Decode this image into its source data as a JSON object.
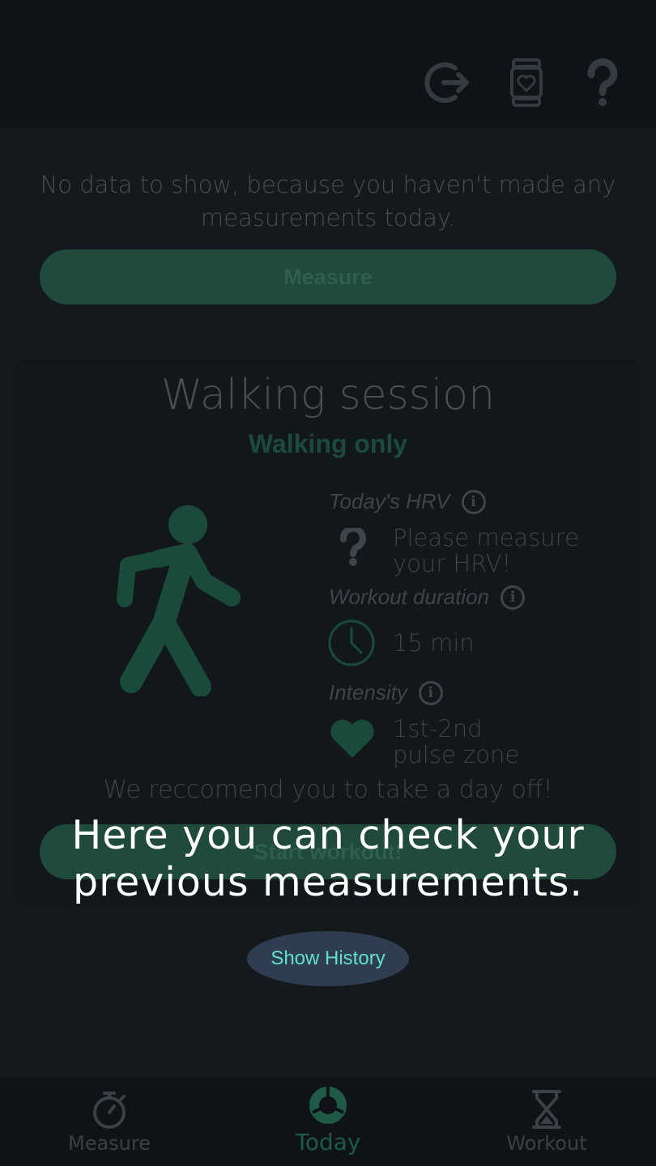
{
  "topbar": {
    "icons": [
      "logout-icon",
      "watch-heart-icon",
      "help-icon"
    ]
  },
  "today": {
    "no_data": "No data to show, because you haven't made any measurements today.",
    "measure_button": "Measure"
  },
  "session": {
    "title": "Walking session",
    "subtitle": "Walking only",
    "hrv_label": "Today's HRV",
    "hrv_value_line1": "Please measure",
    "hrv_value_line2": "your HRV!",
    "duration_label": "Workout duration",
    "duration_value": "15 min",
    "intensity_label": "Intensity",
    "intensity_line1": "1st-2nd",
    "intensity_line2": "pulse zone",
    "recommendation": "We reccomend you to take a day off!",
    "start_button": "Start workout!"
  },
  "tutorial": {
    "line1": "Here you can check your",
    "line2": "previous measurements.",
    "history_button": "Show History"
  },
  "bottom_nav": {
    "items": [
      {
        "label": "Measure",
        "icon": "stopwatch-icon"
      },
      {
        "label": "Today",
        "icon": "ring-icon",
        "active": true
      },
      {
        "label": "Workout",
        "icon": "hourglass-icon"
      }
    ]
  },
  "colors": {
    "accent": "#1f4a3c",
    "active_tab": "#1e5a45",
    "history_text": "#5fe0cf"
  }
}
